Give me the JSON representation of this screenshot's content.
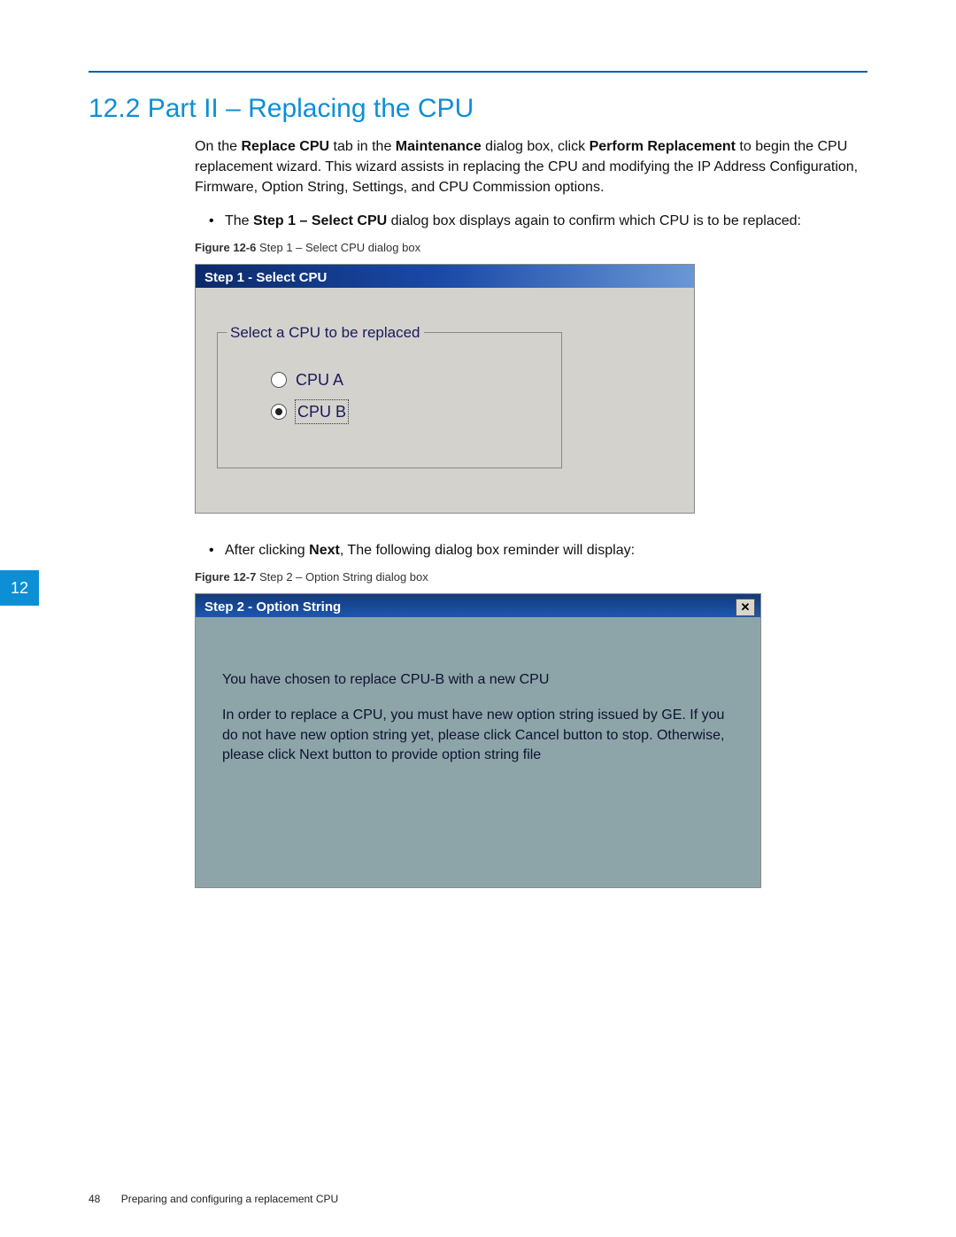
{
  "page": {
    "number": "48",
    "running_title": "Preparing and configuring a replacement CPU"
  },
  "side_tab": "12",
  "heading": "12.2 Part II – Replacing the CPU",
  "intro": {
    "pre1": "On the ",
    "bold1": "Replace CPU",
    "mid1": " tab in the ",
    "bold2": "Maintenance",
    "mid2": " dialog box, click ",
    "bold3": "Perform Replacement",
    "post1": " to begin the CPU replacement wizard. This wizard assists in replacing the CPU and modifying the IP Address Configuration, Firmware, Option String, Settings, and CPU Commission options."
  },
  "bullets": {
    "b1_pre": "The ",
    "b1_bold": "Step 1 – Select CPU",
    "b1_post": " dialog box displays again to confirm which CPU is to be replaced:",
    "b2_pre": "After clicking ",
    "b2_bold": "Next",
    "b2_post": ", The following dialog box reminder will display:"
  },
  "fig1": {
    "label": "Figure 12-6",
    "caption": "  Step 1 – Select CPU dialog box"
  },
  "fig2": {
    "label": "Figure 12-7",
    "caption": "  Step 2 – Option String dialog box"
  },
  "dialog1": {
    "title": "Step 1 - Select CPU",
    "legend": "Select a CPU to be replaced",
    "option_a": "CPU A",
    "option_b": "CPU B"
  },
  "dialog2": {
    "title": "Step 2 - Option String",
    "line1": "You have chosen to replace CPU-B with a new CPU",
    "line2": "In order to replace a CPU, you must have new option string issued by GE. If you do not have new option string yet, please click Cancel button to stop. Otherwise, please click Next button to provide option string file"
  }
}
